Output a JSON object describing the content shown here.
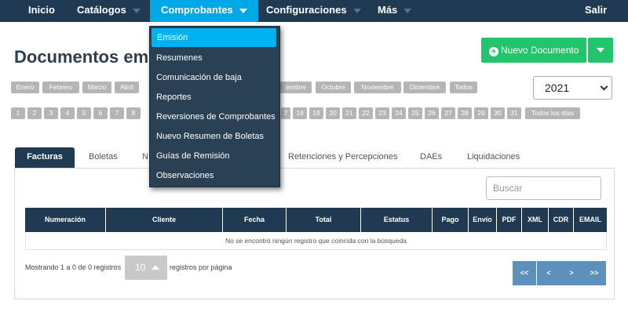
{
  "nav": {
    "inicio": "Inicio",
    "catalogos": "Catálogos",
    "comprobantes": "Comprobantes",
    "configuraciones": "Configuraciones",
    "mas": "Más",
    "salir": "Salir"
  },
  "dropdown": [
    "Emisión",
    "Resumenes",
    "Comunicación de baja",
    "Reportes",
    "Reversiones de Comprobantes",
    "Nuevo Resumen de Boletas",
    "Guías de Remisión",
    "Observaciones"
  ],
  "page_title": "Documentos emi",
  "new_doc_label": "Nuevo Documento",
  "months": [
    "Enero",
    "Febrero",
    "Marzo",
    "Abril",
    "iembre",
    "Octubre",
    "Noviembre",
    "Diciembre",
    "Todos"
  ],
  "days_left": [
    "1",
    "2",
    "3",
    "4",
    "5",
    "6",
    "7",
    "8"
  ],
  "days_right": [
    "7",
    "18",
    "19",
    "20",
    "21",
    "22",
    "23",
    "24",
    "25",
    "26",
    "27",
    "28",
    "29",
    "30",
    "31"
  ],
  "days_all": "Todos los días",
  "year": "2021",
  "tabs": {
    "facturas": "Facturas",
    "boletas": "Boletas",
    "n": "N",
    "retenciones": "Retenciones y Percepciones",
    "daes": "DAEs",
    "liquidaciones": "Liquidaciones"
  },
  "search_placeholder": "Buscar",
  "columns": [
    "Numeración",
    "Cliente",
    "Fecha",
    "Total",
    "Estatus",
    "Pago",
    "Envío",
    "PDF",
    "XML",
    "CDR",
    "EMAIL"
  ],
  "empty_message": "No se encontró ningún registro que coincida con la búsqueda",
  "showing": "Mostrando 1 a 0 de 0 registros",
  "page_size": "10",
  "per_page": "registros por página",
  "pager": [
    "<<",
    "<",
    ">",
    ">>"
  ]
}
